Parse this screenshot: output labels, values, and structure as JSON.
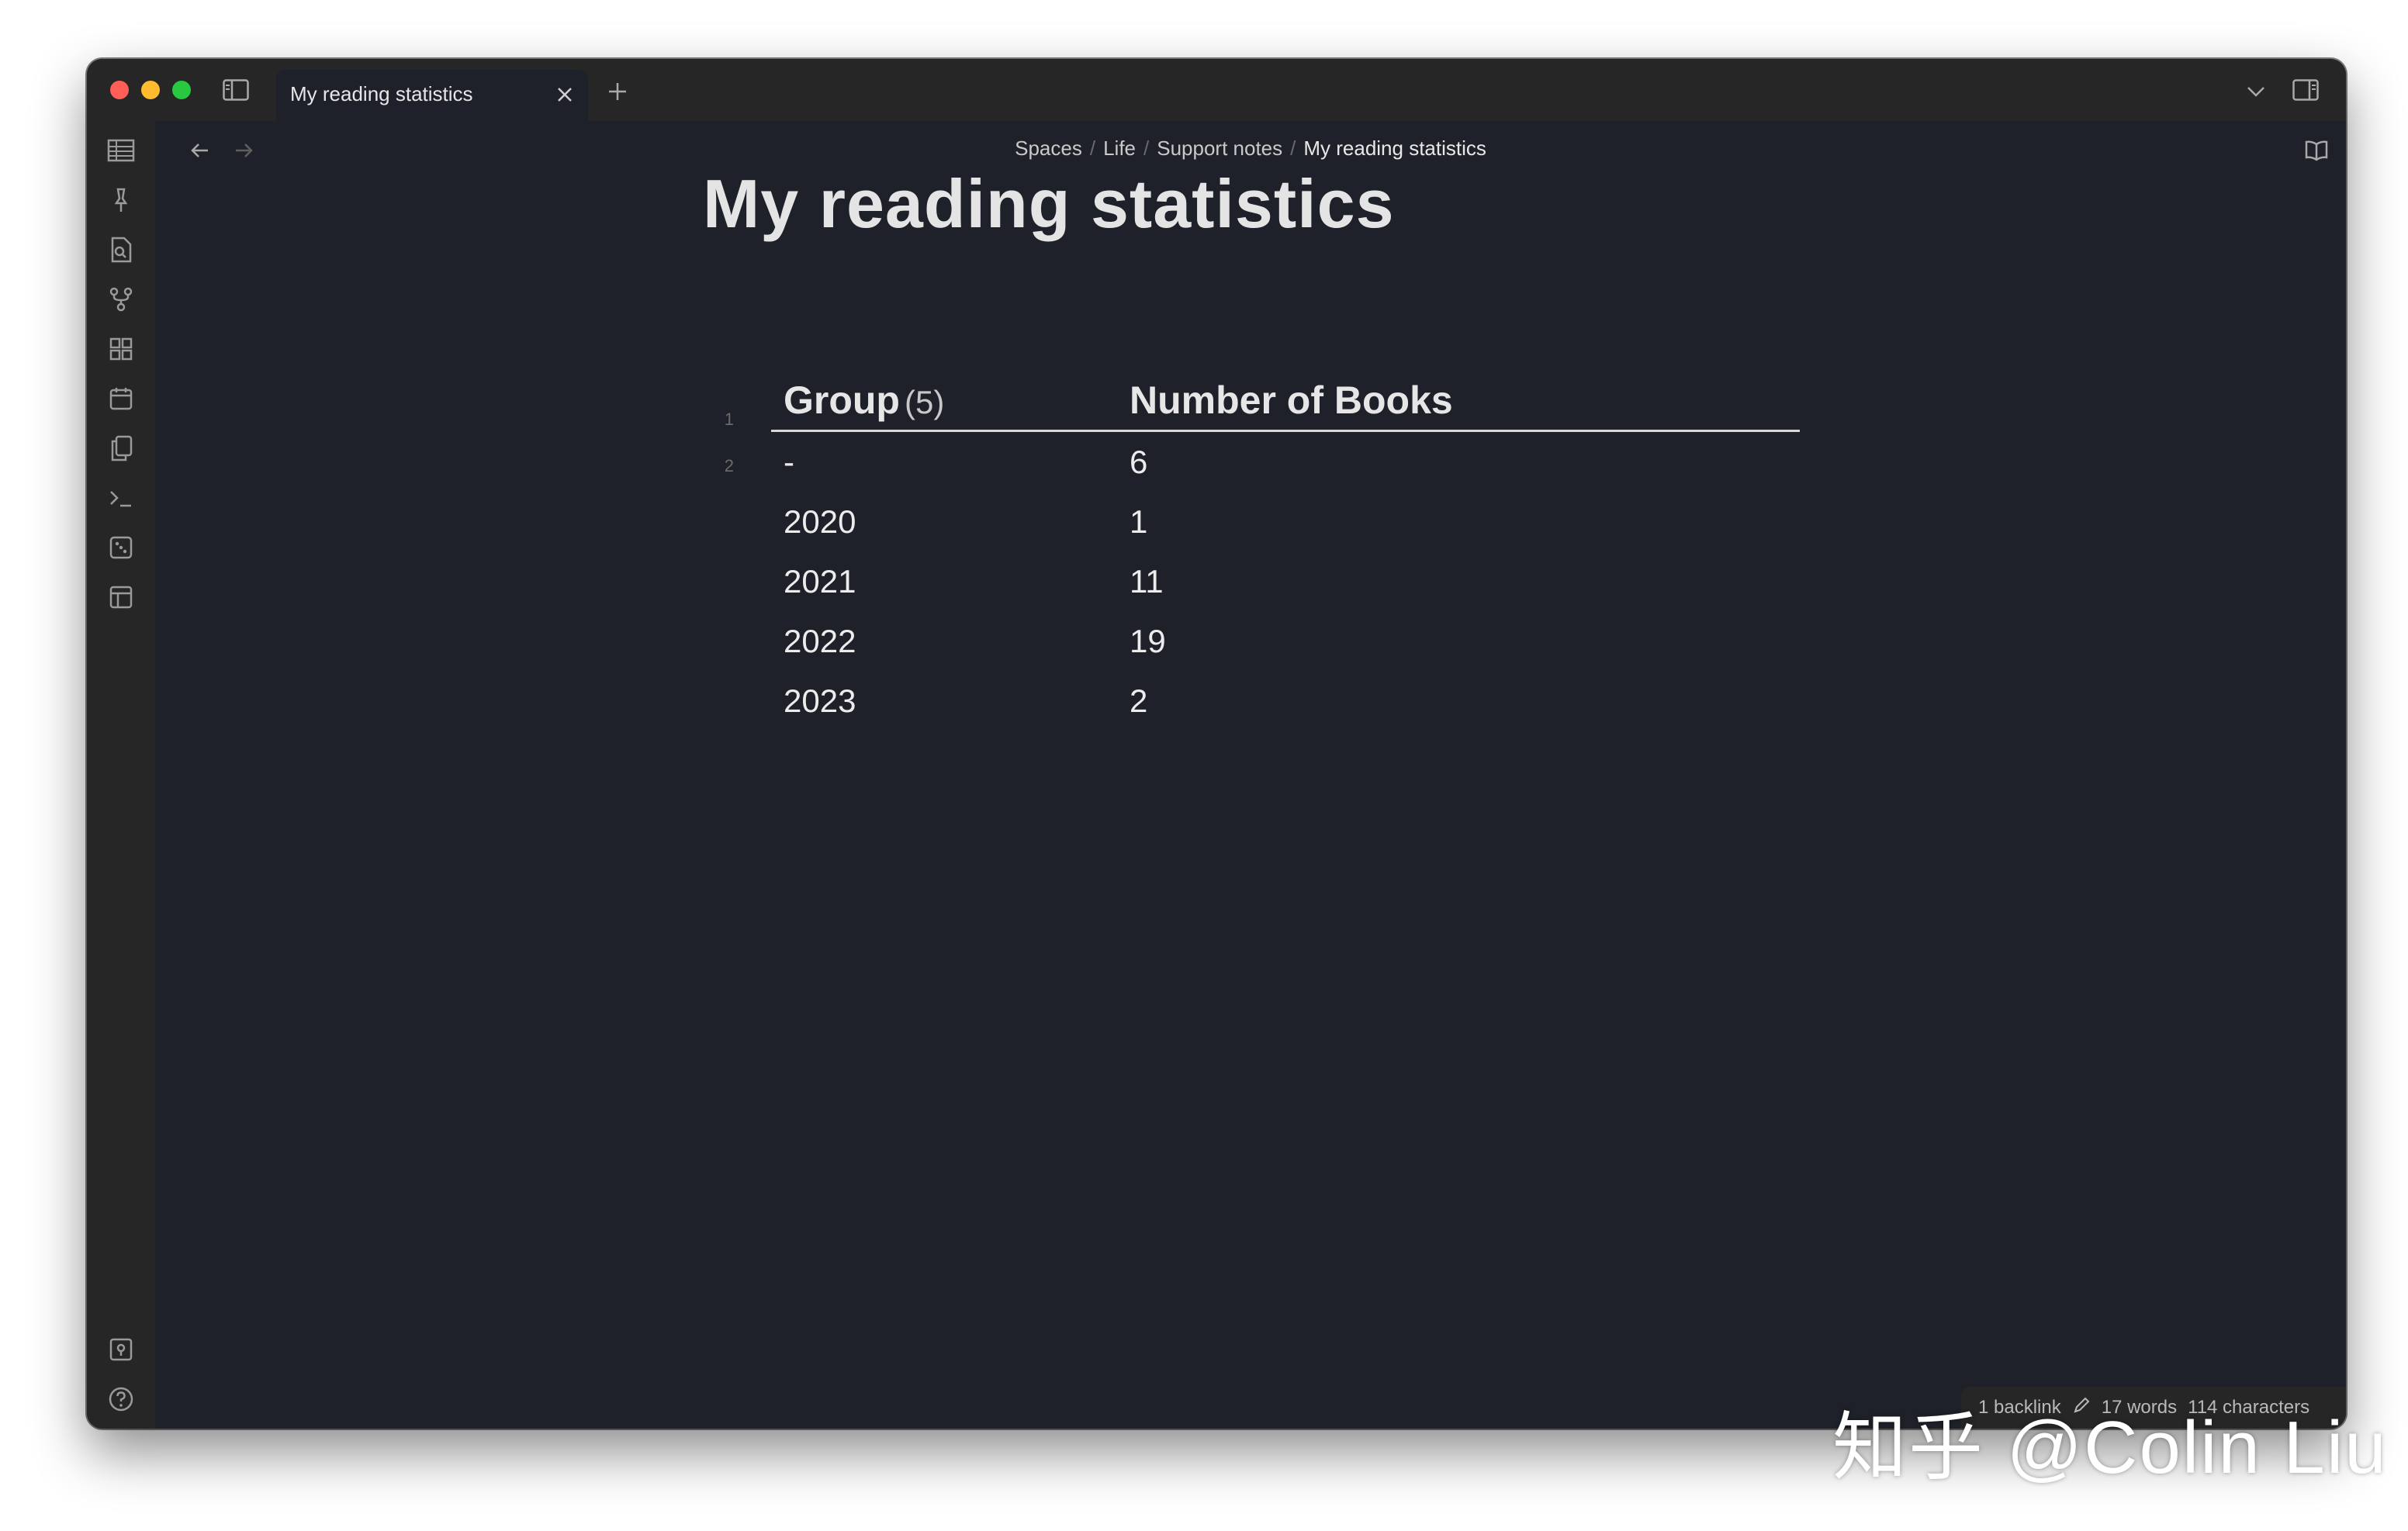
{
  "tab": {
    "title": "My reading statistics"
  },
  "breadcrumb": {
    "items": [
      "Spaces",
      "Life",
      "Support notes",
      "My reading statistics"
    ],
    "separator": "/"
  },
  "note": {
    "title": "My reading statistics",
    "line_numbers": [
      "1",
      "2"
    ]
  },
  "table": {
    "headers": {
      "group": "Group",
      "group_count": "(5)",
      "books": "Number of Books"
    },
    "rows": [
      {
        "group": "-",
        "books": "6"
      },
      {
        "group": "2020",
        "books": "1"
      },
      {
        "group": "2021",
        "books": "11"
      },
      {
        "group": "2022",
        "books": "19"
      },
      {
        "group": "2023",
        "books": "2"
      }
    ]
  },
  "status": {
    "backlinks": "1 backlink",
    "words": "17 words",
    "characters": "114 characters"
  },
  "watermark": {
    "text": "知乎 @Colin Liu"
  },
  "colors": {
    "background": "#1e2129",
    "chrome": "#262626",
    "text": "#e6e6e6",
    "muted": "#6b6b6b"
  },
  "icons": {
    "ribbon_top": [
      "table-icon",
      "pin-icon",
      "file-search-icon",
      "git-fork-icon",
      "grid-icon",
      "calendar-icon",
      "copy-icon",
      "terminal-icon",
      "dice-icon",
      "layout-icon"
    ],
    "ribbon_bottom": [
      "vault-icon",
      "help-icon",
      "settings-icon"
    ]
  }
}
